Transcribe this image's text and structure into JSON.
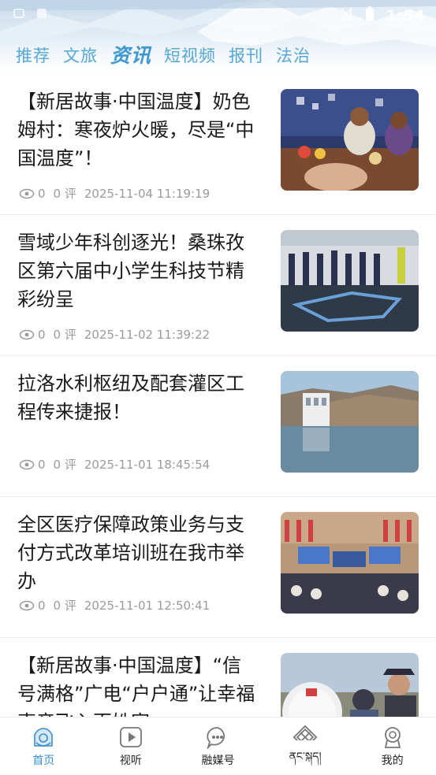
{
  "status_bar": {
    "time": "1:54"
  },
  "tabs": [
    {
      "label": "推荐",
      "active": false
    },
    {
      "label": "文旅",
      "active": false
    },
    {
      "label": "资讯",
      "active": true
    },
    {
      "label": "短视频",
      "active": false
    },
    {
      "label": "报刊",
      "active": false
    },
    {
      "label": "法治",
      "active": false
    }
  ],
  "news": [
    {
      "title": "【新居故事·中国温度】奶色姆村：寒夜炉火暖，尽是“中国温度”！",
      "views": "0",
      "comments": "0 评",
      "time": "2025-11-04 11:19:19"
    },
    {
      "title": "雪域少年科创逐光！桑珠孜区第六届中小学生科技节精彩纷呈",
      "views": "0",
      "comments": "0 评",
      "time": "2025-11-02 11:39:22"
    },
    {
      "title": "拉洛水利枢纽及配套灌区工程传来捷报！",
      "views": "0",
      "comments": "0 评",
      "time": "2025-11-01 18:45:54"
    },
    {
      "title": "全区医疗保障政策业务与支付方式改革培训班在我市举办",
      "views": "0",
      "comments": "0 评",
      "time": "2025-11-01 12:50:41"
    },
    {
      "title": "【新居故事·中国温度】“信号满格”广电“户户通”让幸福声音飞入百姓家",
      "views": "",
      "comments": "",
      "time": ""
    }
  ],
  "bottom_nav": [
    {
      "label": "首页",
      "icon": "home-icon",
      "active": true
    },
    {
      "label": "视听",
      "icon": "play-icon",
      "active": false
    },
    {
      "label": "融媒号",
      "icon": "chat-icon",
      "active": false
    },
    {
      "label": "ནང་སྐད།",
      "icon": "knot-icon",
      "active": false
    },
    {
      "label": "我的",
      "icon": "user-icon",
      "active": false
    }
  ],
  "colors": {
    "accent": "#3a8fd0",
    "tab": "#58a8d8",
    "meta": "#9a9a9a"
  }
}
